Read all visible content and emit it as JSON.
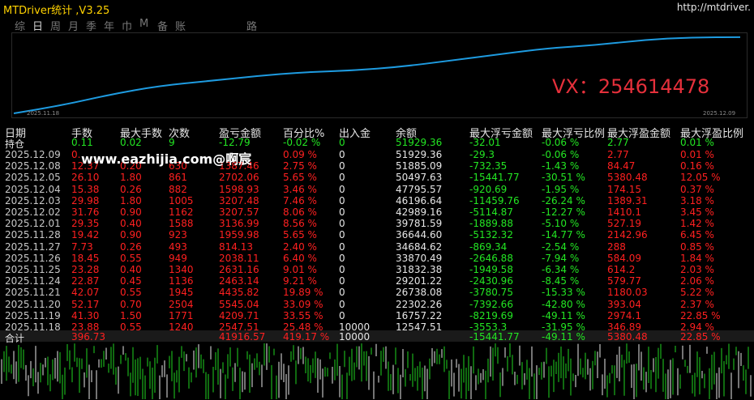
{
  "titlebar": {
    "title": "MTDriver统计 ,V3.25",
    "url": "http://mtdriver."
  },
  "tabs": [
    "综",
    "日",
    "周",
    "月",
    "季",
    "年",
    "巾",
    "M",
    "备",
    "账户",
    "路径"
  ],
  "active_tab": "日",
  "equity_chart": {
    "start_date": "2025.11.18",
    "end_date": "2025.12.09",
    "line_color": "#1e9be0",
    "values": [
      12547.51,
      16757.22,
      22302.26,
      26738.08,
      29201.22,
      31832.38,
      33870.49,
      34684.62,
      36644.6,
      39781.59,
      42989.16,
      46196.64,
      47795.57,
      50497.63,
      51885.09,
      51929.36
    ]
  },
  "vx_label": "VX：254614478",
  "watermark": "www.eazhijia.com@啊宸",
  "table": {
    "headers": [
      "日期",
      "手数",
      "最大手数",
      "次数",
      "盈亏金额",
      "百分比%",
      "出入金",
      "余额",
      "最大浮亏金额",
      "最大浮亏比例",
      "最大浮盈金额",
      "最大浮盈比例"
    ],
    "holding": {
      "label": "持仓",
      "lots": "0.11",
      "max_lots": "0.02",
      "count": "9",
      "pnl": "-12.79",
      "pct": "-0.02 %",
      "io": "0",
      "balance": "51929.36",
      "max_dd": "-32.01",
      "max_dd_pct": "-0.06 %",
      "max_fp": "2.77",
      "max_fp_pct": "0.01 %"
    },
    "rows": [
      {
        "date": "2025.12.09",
        "lots": "0.",
        "max_lots": "",
        "count": "",
        "pnl": "",
        "pct": "0.09 %",
        "io": "0",
        "balance": "51929.36",
        "max_dd": "-29.3",
        "max_dd_pct": "-0.06 %",
        "max_fp": "2.77",
        "max_fp_pct": "0.01 %"
      },
      {
        "date": "2025.12.08",
        "lots": "12.37",
        "max_lots": "0.20",
        "count": "630",
        "pnl": "1387.46",
        "pct": "2.75 %",
        "io": "0",
        "balance": "51885.09",
        "max_dd": "-732.35",
        "max_dd_pct": "-1.43 %",
        "max_fp": "84.47",
        "max_fp_pct": "0.16 %"
      },
      {
        "date": "2025.12.05",
        "lots": "26.10",
        "max_lots": "1.80",
        "count": "861",
        "pnl": "2702.06",
        "pct": "5.65 %",
        "io": "0",
        "balance": "50497.63",
        "max_dd": "-15441.77",
        "max_dd_pct": "-30.51 %",
        "max_fp": "5380.48",
        "max_fp_pct": "12.05 %"
      },
      {
        "date": "2025.12.04",
        "lots": "15.38",
        "max_lots": "0.26",
        "count": "882",
        "pnl": "1598.93",
        "pct": "3.46 %",
        "io": "0",
        "balance": "47795.57",
        "max_dd": "-920.69",
        "max_dd_pct": "-1.95 %",
        "max_fp": "174.15",
        "max_fp_pct": "0.37 %"
      },
      {
        "date": "2025.12.03",
        "lots": "29.98",
        "max_lots": "1.80",
        "count": "1005",
        "pnl": "3207.48",
        "pct": "7.46 %",
        "io": "0",
        "balance": "46196.64",
        "max_dd": "-11459.76",
        "max_dd_pct": "-26.24 %",
        "max_fp": "1389.31",
        "max_fp_pct": "3.18 %"
      },
      {
        "date": "2025.12.02",
        "lots": "31.76",
        "max_lots": "0.90",
        "count": "1162",
        "pnl": "3207.57",
        "pct": "8.06 %",
        "io": "0",
        "balance": "42989.16",
        "max_dd": "-5114.87",
        "max_dd_pct": "-12.27 %",
        "max_fp": "1410.1",
        "max_fp_pct": "3.45 %"
      },
      {
        "date": "2025.12.01",
        "lots": "29.35",
        "max_lots": "0.40",
        "count": "1588",
        "pnl": "3136.99",
        "pct": "8.56 %",
        "io": "0",
        "balance": "39781.59",
        "max_dd": "-1889.88",
        "max_dd_pct": "-5.10 %",
        "max_fp": "527.19",
        "max_fp_pct": "1.42 %"
      },
      {
        "date": "2025.11.28",
        "lots": "19.42",
        "max_lots": "0.90",
        "count": "923",
        "pnl": "1959.98",
        "pct": "5.65 %",
        "io": "0",
        "balance": "36644.60",
        "max_dd": "-5132.32",
        "max_dd_pct": "-14.77 %",
        "max_fp": "2142.96",
        "max_fp_pct": "6.45 %"
      },
      {
        "date": "2025.11.27",
        "lots": "7.73",
        "max_lots": "0.26",
        "count": "493",
        "pnl": "814.13",
        "pct": "2.40 %",
        "io": "0",
        "balance": "34684.62",
        "max_dd": "-869.34",
        "max_dd_pct": "-2.54 %",
        "max_fp": "288",
        "max_fp_pct": "0.85 %"
      },
      {
        "date": "2025.11.26",
        "lots": "18.45",
        "max_lots": "0.55",
        "count": "949",
        "pnl": "2038.11",
        "pct": "6.40 %",
        "io": "0",
        "balance": "33870.49",
        "max_dd": "-2646.88",
        "max_dd_pct": "-7.94 %",
        "max_fp": "584.09",
        "max_fp_pct": "1.84 %"
      },
      {
        "date": "2025.11.25",
        "lots": "23.28",
        "max_lots": "0.40",
        "count": "1340",
        "pnl": "2631.16",
        "pct": "9.01 %",
        "io": "0",
        "balance": "31832.38",
        "max_dd": "-1949.58",
        "max_dd_pct": "-6.34 %",
        "max_fp": "614.2",
        "max_fp_pct": "2.03 %"
      },
      {
        "date": "2025.11.24",
        "lots": "22.87",
        "max_lots": "0.45",
        "count": "1136",
        "pnl": "2463.14",
        "pct": "9.21 %",
        "io": "0",
        "balance": "29201.22",
        "max_dd": "-2430.96",
        "max_dd_pct": "-8.45 %",
        "max_fp": "579.77",
        "max_fp_pct": "2.06 %"
      },
      {
        "date": "2025.11.21",
        "lots": "42.07",
        "max_lots": "0.55",
        "count": "1945",
        "pnl": "4435.82",
        "pct": "19.89 %",
        "io": "0",
        "balance": "26738.08",
        "max_dd": "-3780.75",
        "max_dd_pct": "-15.33 %",
        "max_fp": "1180.03",
        "max_fp_pct": "5.22 %"
      },
      {
        "date": "2025.11.20",
        "lots": "52.17",
        "max_lots": "0.70",
        "count": "2504",
        "pnl": "5545.04",
        "pct": "33.09 %",
        "io": "0",
        "balance": "22302.26",
        "max_dd": "-7392.66",
        "max_dd_pct": "-42.80 %",
        "max_fp": "393.04",
        "max_fp_pct": "2.37 %"
      },
      {
        "date": "2025.11.19",
        "lots": "41.30",
        "max_lots": "1.50",
        "count": "1771",
        "pnl": "4209.71",
        "pct": "33.55 %",
        "io": "0",
        "balance": "16757.22",
        "max_dd": "-8219.69",
        "max_dd_pct": "-49.11 %",
        "max_fp": "2974.1",
        "max_fp_pct": "22.85 %"
      },
      {
        "date": "2025.11.18",
        "lots": "23.88",
        "max_lots": "0.55",
        "count": "1240",
        "pnl": "2547.51",
        "pct": "25.48 %",
        "io": "10000",
        "balance": "12547.51",
        "max_dd": "-3553.3",
        "max_dd_pct": "-31.95 %",
        "max_fp": "346.89",
        "max_fp_pct": "2.94 %"
      }
    ],
    "total": {
      "label": "合计",
      "lots": "396.73",
      "max_lots": "",
      "count": "",
      "pnl": "41916.57",
      "pct": "419.17 %",
      "io": "10000",
      "balance": "",
      "max_dd": "-15441.77",
      "max_dd_pct": "-49.11 %",
      "max_fp": "5380.48",
      "max_fp_pct": "22.85 %"
    }
  }
}
